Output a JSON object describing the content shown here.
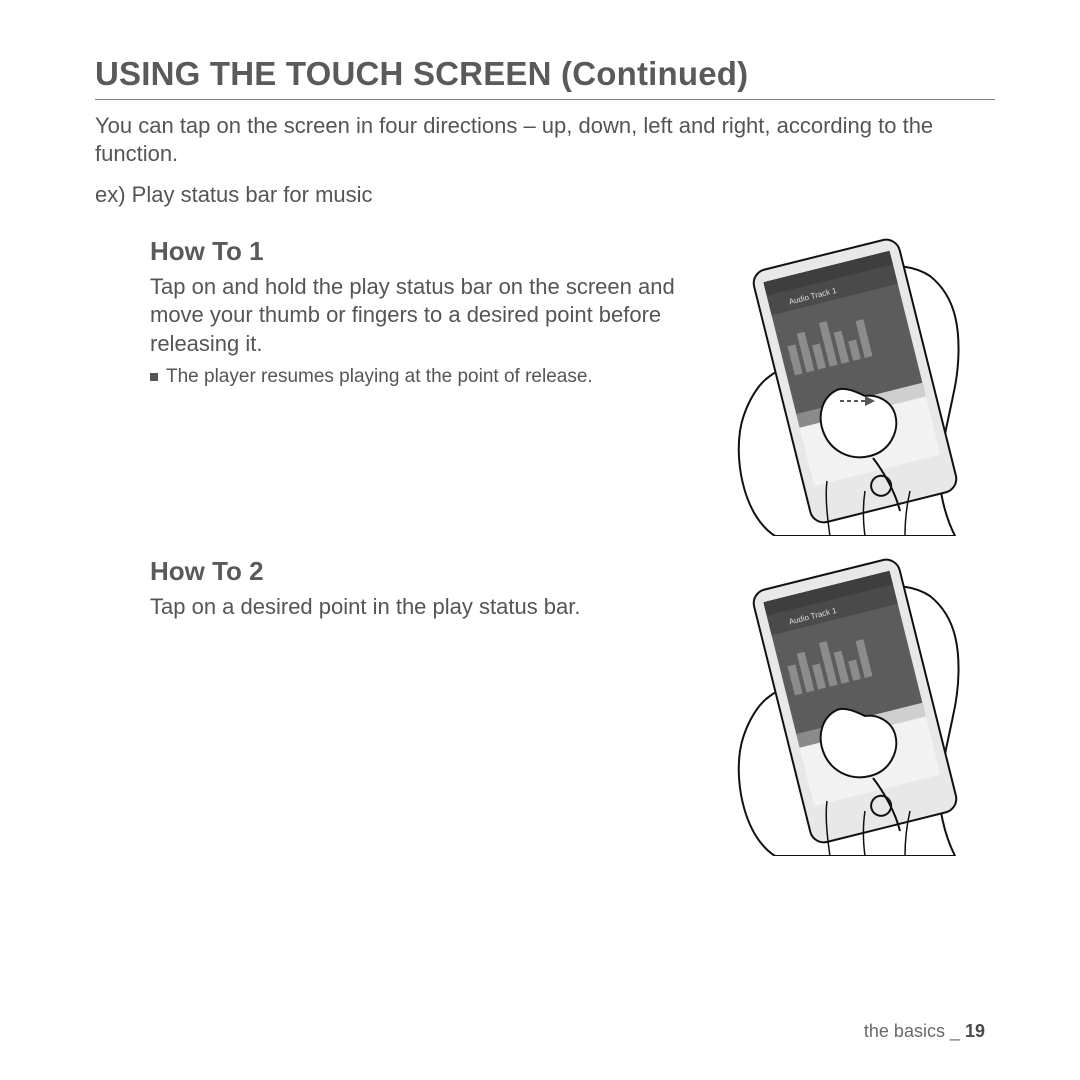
{
  "title": "USING THE TOUCH SCREEN (Continued)",
  "intro": "You can tap on the screen in four directions – up, down, left and right, according to the function.",
  "example": "ex) Play status bar for music",
  "howto1": {
    "heading": "How To 1",
    "body": "Tap on and hold the play status bar on the screen and move your thumb or fingers to a desired point before releasing it.",
    "bullet": "The player resumes playing at the point of release."
  },
  "howto2": {
    "heading": "How To 2",
    "body": "Tap on a desired point in the play status bar."
  },
  "device_track_label": "Audio Track 1",
  "footer": {
    "section": "the basics _ ",
    "page": "19"
  }
}
